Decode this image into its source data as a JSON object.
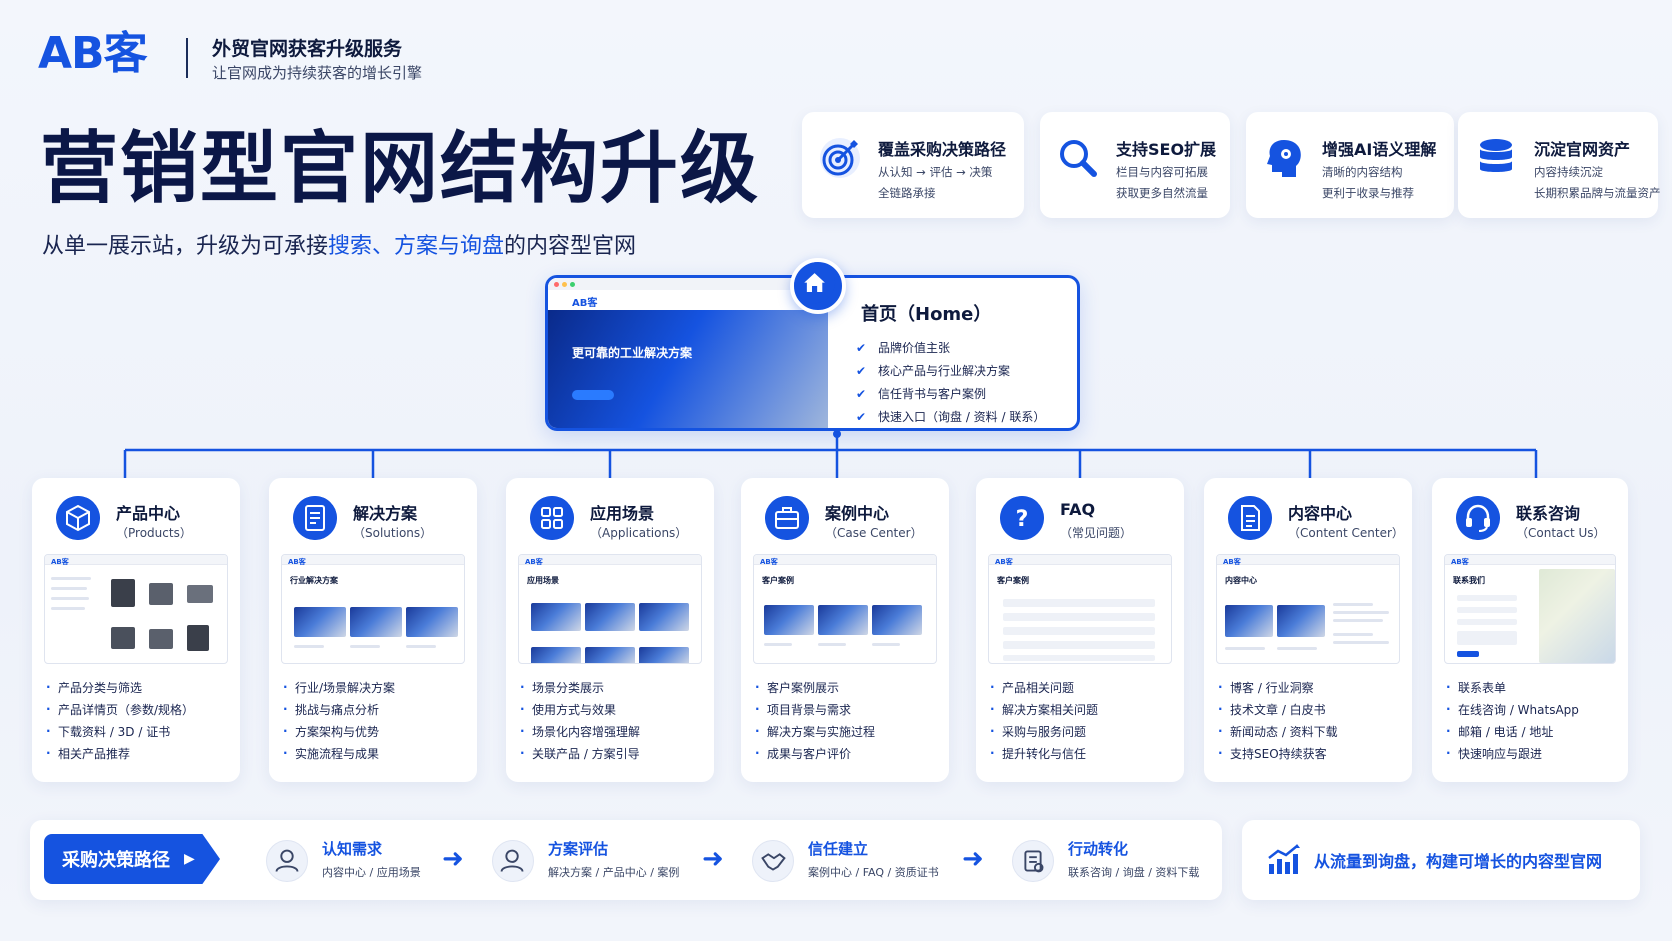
{
  "header": {
    "logo": "AB客",
    "tagline_title": "外贸官网获客升级服务",
    "tagline_sub": "让官网成为持续获客的增长引擎",
    "main_title": "营销型官网结构升级",
    "subtitle_pre": "从单一展示站，升级为可承接",
    "subtitle_hl1": "搜索、方案与询盘",
    "subtitle_post": "的内容型官网"
  },
  "features": [
    {
      "icon": "target-icon",
      "title": "覆盖采购决策路径",
      "line1": "从认知 → 评估 → 决策",
      "line2": "全链路承接"
    },
    {
      "icon": "search-icon",
      "title": "支持SEO扩展",
      "line1": "栏目与内容可拓展",
      "line2": "获取更多自然流量"
    },
    {
      "icon": "ai-head-icon",
      "title": "增强AI语义理解",
      "line1": "清晰的内容结构",
      "line2": "更利于收录与推荐"
    },
    {
      "icon": "database-icon",
      "title": "沉淀官网资产",
      "line1": "内容持续沉淀",
      "line2": "长期积累品牌与流量资产"
    }
  ],
  "home": {
    "title": "首页（Home）",
    "shot_logo": "AB客",
    "shot_hero": "更可靠的工业解决方案",
    "items": [
      "品牌价值主张",
      "核心产品与行业解决方案",
      "信任背书与客户案例",
      "快速入口（询盘 / 资料 / 联系）"
    ]
  },
  "sections": [
    {
      "icon": "cube-icon",
      "title": "产品中心",
      "sub": "（Products）",
      "shot_heading": "",
      "items": [
        "产品分类与筛选",
        "产品详情页（参数/规格）",
        "下载资料 / 3D / 证书",
        "相关产品推荐"
      ]
    },
    {
      "icon": "document-icon",
      "title": "解决方案",
      "sub": "（Solutions）",
      "shot_heading": "行业解决方案",
      "items": [
        "行业/场景解决方案",
        "挑战与痛点分析",
        "方案架构与优势",
        "实施流程与成果"
      ]
    },
    {
      "icon": "grid-icon",
      "title": "应用场景",
      "sub": "（Applications）",
      "shot_heading": "应用场景",
      "items": [
        "场景分类展示",
        "使用方式与效果",
        "场景化内容增强理解",
        "关联产品 / 方案引导"
      ]
    },
    {
      "icon": "briefcase-icon",
      "title": "案例中心",
      "sub": "（Case Center）",
      "shot_heading": "客户案例",
      "items": [
        "客户案例展示",
        "项目背景与需求",
        "解决方案与实施过程",
        "成果与客户评价"
      ]
    },
    {
      "icon": "question-icon",
      "title": "FAQ",
      "sub": "（常见问题）",
      "shot_heading": "客户案例",
      "items": [
        "产品相关问题",
        "解决方案相关问题",
        "采购与服务问题",
        "提升转化与信任"
      ]
    },
    {
      "icon": "file-icon",
      "title": "内容中心",
      "sub": "（Content Center）",
      "shot_heading": "内容中心",
      "items": [
        "博客 / 行业洞察",
        "技术文章 / 白皮书",
        "新闻动态 / 资料下载",
        "支持SEO持续获客"
      ]
    },
    {
      "icon": "headset-icon",
      "title": "联系咨询",
      "sub": "（Contact Us）",
      "shot_heading": "联系我们",
      "items": [
        "联系表单",
        "在线咨询 / WhatsApp",
        "邮箱 / 电话 / 地址",
        "快速响应与跟进"
      ]
    }
  ],
  "path": {
    "button": "采购决策路径",
    "steps": [
      {
        "icon": "user-icon",
        "title": "认知需求",
        "sub": "内容中心 / 应用场景"
      },
      {
        "icon": "user-search-icon",
        "title": "方案评估",
        "sub": "解决方案 / 产品中心 / 案例"
      },
      {
        "icon": "handshake-icon",
        "title": "信任建立",
        "sub": "案例中心 / FAQ / 资质证书"
      },
      {
        "icon": "form-icon",
        "title": "行动转化",
        "sub": "联系咨询 / 询盘 / 资料下载"
      }
    ]
  },
  "slogan": "从流量到询盘，构建可增长的内容型官网",
  "colors": {
    "accent": "#1553e0",
    "dark": "#0b1747",
    "bg": "#f3f6fc"
  }
}
